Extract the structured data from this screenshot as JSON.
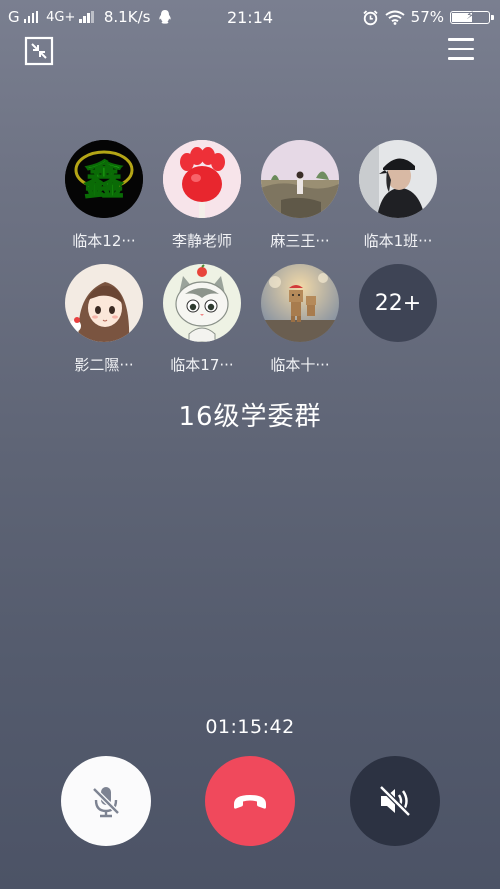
{
  "status_bar": {
    "carrier1": "G",
    "carrier2": "4G+",
    "speed": "8.1K/s",
    "time": "21:14",
    "battery_percent": "57%",
    "battery_level": 0.57
  },
  "members": [
    {
      "name": "临本12···",
      "avatar": "xin-logo"
    },
    {
      "name": "李静老师",
      "avatar": "paw-candy"
    },
    {
      "name": "麻三王···",
      "avatar": "outdoor-photo"
    },
    {
      "name": "临本1班···",
      "avatar": "cap-person"
    },
    {
      "name": "影二隰···",
      "avatar": "anime-girl"
    },
    {
      "name": "临本17···",
      "avatar": "cartoon-cat"
    },
    {
      "name": "临本十···",
      "avatar": "danbo-figure"
    }
  ],
  "more_count": "22+",
  "group_name": "16级学委群",
  "call_duration": "01:15:42",
  "avatar_logo_char": "鑫",
  "colors": {
    "hangup": "#f0495c",
    "mute_bg": "#fbfbfc",
    "speaker_bg": "#2c3242"
  },
  "icons": {
    "minimize": "minimize-arrows-icon",
    "menu": "menu-icon",
    "mute": "mic-off-icon",
    "hangup": "phone-hangup-icon",
    "speaker": "speaker-off-icon"
  }
}
